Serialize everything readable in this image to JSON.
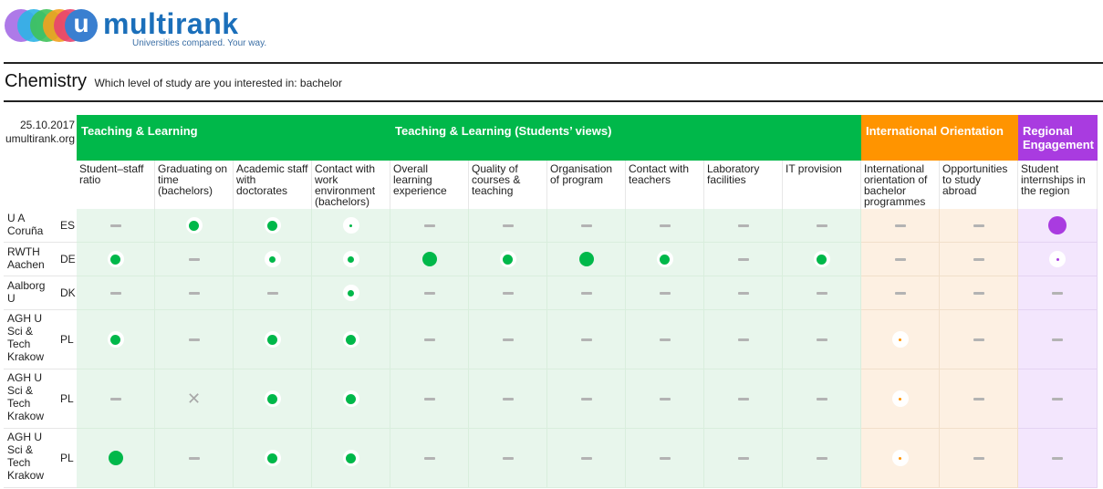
{
  "brand": {
    "name": "multirank",
    "badge_letter": "u",
    "tagline": "Universities compared. Your way."
  },
  "header": {
    "subject": "Chemistry",
    "question": "Which level of study are you interested in: bachelor"
  },
  "meta": {
    "date": "25.10.2017",
    "site": "umultirank.org"
  },
  "colors": {
    "green": "#00b84a",
    "orange": "#ff9400",
    "purple": "#a93be0"
  },
  "groups": [
    {
      "label": "Teaching & Learning",
      "color": "#00b84a"
    },
    {
      "label": "Teaching & Learning (Students’ views)",
      "color": "#00b84a"
    },
    {
      "label": "International Orientation",
      "color": "#ff9400"
    },
    {
      "label": "Regional Engagement",
      "color": "#a93be0"
    }
  ],
  "indicators": [
    "Student–staff ratio",
    "Graduating on time (bachelors)",
    "Academic staff with doctorates",
    "Contact with work environment (bachelors)",
    "Overall learning experience",
    "Quality of courses & teaching",
    "Organisation of program",
    "Contact with teachers",
    "Laboratory facilities",
    "IT provision",
    "International orientation of bachelor programmes",
    "Opportunities to study abroad",
    "Student internships in the region"
  ],
  "universities": [
    {
      "name": "U A Coruña",
      "country": "ES",
      "scores": [
        "dash",
        "medium",
        "medium",
        "tiny",
        "dash",
        "dash",
        "dash",
        "dash",
        "dash",
        "dash",
        "dash",
        "dash",
        "large"
      ]
    },
    {
      "name": "RWTH Aachen",
      "country": "DE",
      "scores": [
        "medium",
        "dash",
        "small",
        "small",
        "large",
        "medium",
        "large",
        "medium",
        "dash",
        "medium",
        "dash",
        "dash",
        "tiny"
      ]
    },
    {
      "name": "Aalborg U",
      "country": "DK",
      "scores": [
        "dash",
        "dash",
        "dash",
        "small",
        "dash",
        "dash",
        "dash",
        "dash",
        "dash",
        "dash",
        "dash",
        "dash",
        "dash"
      ]
    },
    {
      "name": "AGH U Sci & Tech Krakow",
      "country": "PL",
      "scores": [
        "medium",
        "dash",
        "medium",
        "medium",
        "dash",
        "dash",
        "dash",
        "dash",
        "dash",
        "dash",
        "tiny",
        "dash",
        "dash"
      ]
    },
    {
      "name": "AGH U Sci & Tech Krakow",
      "country": "PL",
      "scores": [
        "dash",
        "cross",
        "medium",
        "medium",
        "dash",
        "dash",
        "dash",
        "dash",
        "dash",
        "dash",
        "tiny",
        "dash",
        "dash"
      ]
    },
    {
      "name": "AGH U Sci & Tech Krakow",
      "country": "PL",
      "scores": [
        "large",
        "dash",
        "medium",
        "medium",
        "dash",
        "dash",
        "dash",
        "dash",
        "dash",
        "dash",
        "tiny",
        "dash",
        "dash"
      ]
    }
  ]
}
